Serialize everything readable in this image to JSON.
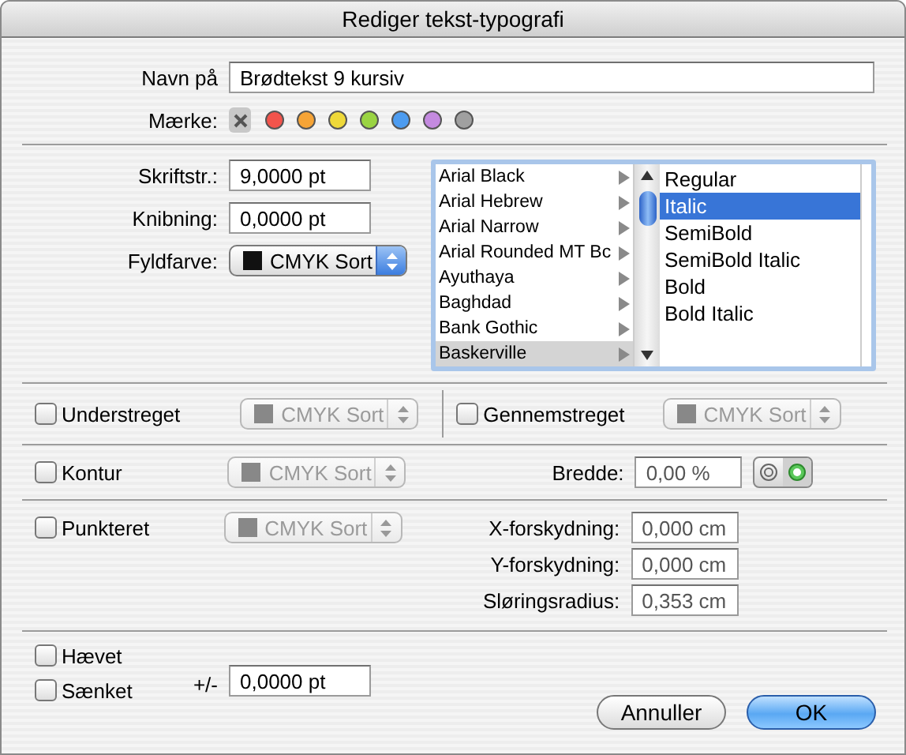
{
  "window": {
    "title": "Rediger tekst-typografi"
  },
  "name": {
    "label": "Navn på",
    "value": "Brødtekst 9 kursiv"
  },
  "tag": {
    "label": "Mærke:",
    "options": [
      {
        "kind": "none",
        "selected": true
      },
      {
        "kind": "color",
        "color": "#f2544c",
        "selected": false
      },
      {
        "kind": "color",
        "color": "#f6a436",
        "selected": false
      },
      {
        "kind": "color",
        "color": "#efd939",
        "selected": false
      },
      {
        "kind": "color",
        "color": "#9ad442",
        "selected": false
      },
      {
        "kind": "color",
        "color": "#4d9cf0",
        "selected": false
      },
      {
        "kind": "color",
        "color": "#c48ae0",
        "selected": false
      },
      {
        "kind": "color",
        "color": "#a0a0a0",
        "selected": false
      }
    ]
  },
  "font": {
    "size": {
      "label": "Skriftstr.:",
      "value": "9,0000 pt"
    },
    "kerning": {
      "label": "Knibning:",
      "value": "0,0000 pt"
    },
    "fill": {
      "label": "Fyldfarve:",
      "popup": {
        "value": "CMYK Sort",
        "disabled": false
      }
    },
    "families": [
      {
        "name": "Arial Black",
        "selected": false
      },
      {
        "name": "Arial Hebrew",
        "selected": false
      },
      {
        "name": "Arial Narrow",
        "selected": false
      },
      {
        "name": "Arial Rounded MT Bc",
        "selected": false
      },
      {
        "name": "Ayuthaya",
        "selected": false
      },
      {
        "name": "Baghdad",
        "selected": false
      },
      {
        "name": "Bank Gothic",
        "selected": false
      },
      {
        "name": "Baskerville",
        "selected": true
      }
    ],
    "styles": [
      {
        "name": "Regular",
        "selected": false
      },
      {
        "name": "Italic",
        "selected": true
      },
      {
        "name": "SemiBold",
        "selected": false
      },
      {
        "name": "SemiBold Italic",
        "selected": false
      },
      {
        "name": "Bold",
        "selected": false
      },
      {
        "name": "Bold Italic",
        "selected": false
      }
    ]
  },
  "underline": {
    "label": "Understreget",
    "checked": false,
    "popup": {
      "value": "CMYK Sort",
      "disabled": true
    }
  },
  "strikethrough": {
    "label": "Gennemstreget",
    "checked": false,
    "popup": {
      "value": "CMYK Sort",
      "disabled": true
    }
  },
  "outline": {
    "label": "Kontur",
    "checked": false,
    "popup": {
      "value": "CMYK Sort",
      "disabled": true
    },
    "width_label": "Bredde:",
    "width_value": "0,00 %",
    "modes": [
      {
        "kind": "rings",
        "selected": false
      },
      {
        "kind": "ring",
        "selected": true
      }
    ]
  },
  "shadow": {
    "label": "Punkteret",
    "checked": false,
    "popup": {
      "value": "CMYK Sort",
      "disabled": true
    },
    "fields": [
      {
        "label": "X-forskydning:",
        "value": "0,000 cm"
      },
      {
        "label": "Y-forskydning:",
        "value": "0,000 cm"
      },
      {
        "label": "Sløringsradius:",
        "value": "0,353 cm"
      }
    ]
  },
  "baseline": {
    "raised": {
      "label": "Hævet",
      "checked": false
    },
    "lowered": {
      "label": "Sænket",
      "checked": false
    },
    "offset_label": "+/-",
    "offset_value": "0,0000 pt"
  },
  "buttons": [
    {
      "label": "Annuller",
      "kind": "cancel"
    },
    {
      "label": "OK",
      "kind": "default"
    }
  ]
}
